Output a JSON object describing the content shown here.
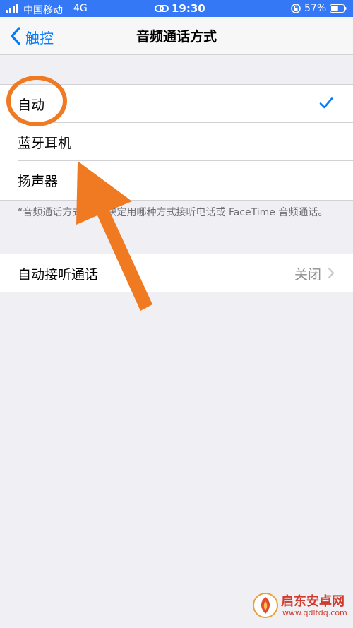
{
  "status_bar": {
    "carrier": "中国移动",
    "network": "4G",
    "time": "19:30",
    "battery_percent": "57%",
    "battery_level": 0.57,
    "background": "#3478f6"
  },
  "nav": {
    "back_label": "触控",
    "title": "音频通话方式"
  },
  "options": [
    {
      "label": "自动",
      "selected": true
    },
    {
      "label": "蓝牙耳机",
      "selected": false
    },
    {
      "label": "扬声器",
      "selected": false
    }
  ],
  "footer_note": "“音频通话方式”用来决定用哪种方式接听电话或 FaceTime 音频通话。",
  "auto_answer": {
    "label": "自动接听通话",
    "value": "关闭"
  },
  "watermark": {
    "name": "启东安卓网",
    "url": "www.qdltdq.com"
  },
  "colors": {
    "accent": "#007aff",
    "annotation": "#f07a22",
    "background": "#efeff4"
  }
}
